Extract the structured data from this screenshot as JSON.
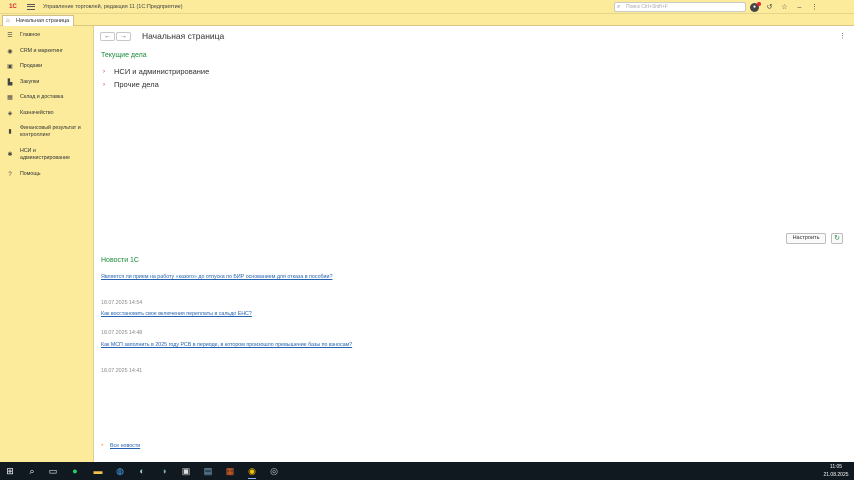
{
  "titlebar": {
    "logo": "1С",
    "title": "Управление торговлей, редакция 11  (1С:Предприятие)",
    "search_placeholder": "Поиск Ctrl+Shift+F"
  },
  "tabs": [
    {
      "label": "Начальная страница"
    }
  ],
  "sidebar": {
    "items": [
      {
        "label": "Главное",
        "icon": "☰"
      },
      {
        "label": "CRM и маркетинг",
        "icon": "◉"
      },
      {
        "label": "Продажи",
        "icon": "▣"
      },
      {
        "label": "Закупки",
        "icon": "▙"
      },
      {
        "label": "Склад и доставка",
        "icon": "▦"
      },
      {
        "label": "Казначейство",
        "icon": "◈"
      },
      {
        "label": "Финансовый результат и контроллинг",
        "icon": "▮"
      },
      {
        "label": "НСИ и администрирование",
        "icon": "✱"
      },
      {
        "label": "Помощь",
        "icon": "?"
      }
    ]
  },
  "main": {
    "page_title": "Начальная страница",
    "current_tasks": {
      "title": "Текущие дела",
      "items": [
        "НСИ и администрирование",
        "Прочие дела"
      ]
    },
    "buttons": {
      "setup": "Настроить"
    },
    "news": {
      "title": "Новости 1С",
      "items": [
        {
          "link": "Является ли прием на работу «казого» до отпуска по БИР основанием для отказа в пособии?",
          "date": "18.07.2025 14:54"
        },
        {
          "link": "Как восстановить свое включения переплаты в сальдо ЕНС?",
          "date": "18.07.2025 14:48"
        },
        {
          "link": "Как МСП заполнить в 2025 году РСВ в периоде, в котором произошло превышение базы по взносам?",
          "date": "18.07.2025 14:41"
        }
      ],
      "all_news": "Все новости"
    }
  },
  "taskbar": {
    "time": "11:05",
    "date": "21.08.2025"
  },
  "colors": {
    "sidebar_bg": "#fbeb9b",
    "section_green": "#1a8a3a",
    "link_blue": "#2563b0",
    "arrow_red": "#c0262b"
  }
}
